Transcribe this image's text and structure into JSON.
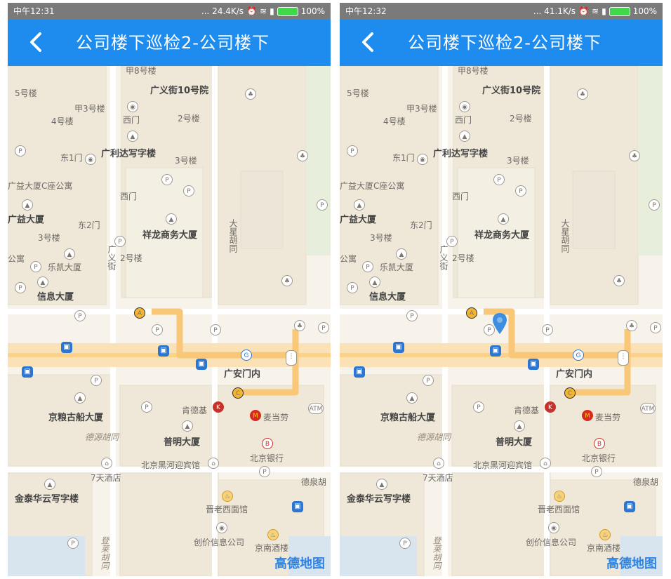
{
  "screens": [
    {
      "status": {
        "time": "中午12:31",
        "speed": "... 24.4K/s",
        "battery": "100%"
      },
      "title": "公司楼下巡检2-公司楼下",
      "show_pin": false
    },
    {
      "status": {
        "time": "中午12:32",
        "speed": "... 41.1K/s",
        "battery": "100%"
      },
      "title": "公司楼下巡检2-公司楼下",
      "show_pin": true
    }
  ],
  "map": {
    "logo": "高德地图",
    "labels": {
      "bldg_jia8": "甲8号楼",
      "b5": "5号楼",
      "guangyijie10": "广义街10号院",
      "jia3": "甲3号楼",
      "b4": "4号楼",
      "ximen1": "西门",
      "b2a": "2号楼",
      "guanglida": "广利达写字楼",
      "dong1men": "东1门",
      "b3a": "3号楼",
      "guangyi_c": "广益大厦C座公寓",
      "ximen2": "西门",
      "guangyi": "广益大厦",
      "dong2men": "东2门",
      "b3b": "3号楼",
      "xianglong": "祥龙商务大厦",
      "daxing": "大星胡同",
      "gongyu": "公寓",
      "b2b": "2号楼",
      "guangyijie": "广义街",
      "lekai": "乐凯大厦",
      "xinxi": "信息大厦",
      "guanganmennei": "广安门内",
      "jingliang": "京粮古船大厦",
      "kfc": "肯德基",
      "mcd": "麦当劳",
      "deyuan": "德源胡同",
      "puming": "普明大厦",
      "bjbank": "北京银行",
      "heihe": "北京黑河迎宾馆",
      "seven": "7天酒店",
      "dequan": "德泉胡",
      "jintai": "金泰华云写字楼",
      "jinlao": "晋老西面馆",
      "chuangjia": "创价信息公司",
      "jingnan": "京南酒楼",
      "denglai": "登莱胡同"
    }
  }
}
